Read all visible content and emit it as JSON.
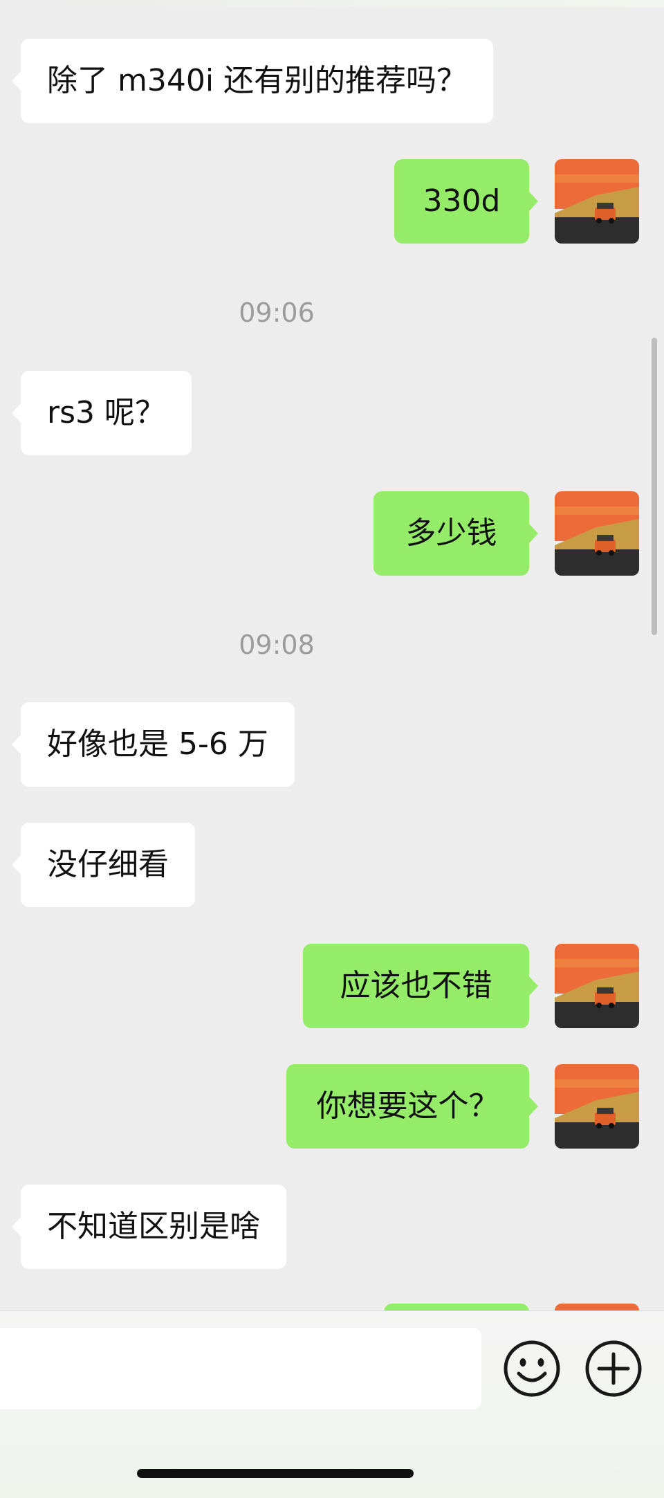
{
  "chat": {
    "messages": [
      {
        "side": "in",
        "text": "除了 m340i 还有别的推荐吗？"
      },
      {
        "side": "out",
        "text": "330d"
      },
      {
        "type": "time",
        "text": "09:06"
      },
      {
        "side": "in",
        "text": "rs3 呢？"
      },
      {
        "side": "out",
        "text": "多少钱"
      },
      {
        "type": "time",
        "text": "09:08"
      },
      {
        "side": "in",
        "text": "好像也是 5-6 万"
      },
      {
        "side": "in",
        "text": "没仔细看"
      },
      {
        "side": "out",
        "text": "应该也不错"
      },
      {
        "side": "out",
        "text": "你想要这个？"
      },
      {
        "side": "in",
        "text": "不知道区别是啥"
      }
    ]
  },
  "input_bar": {
    "text_value": "",
    "emoji_icon": "smiley-face-icon",
    "plus_icon": "plus-circle-icon"
  },
  "colors": {
    "background": "#ededed",
    "incoming_bubble": "#ffffff",
    "outgoing_bubble": "#95ec69",
    "timestamp": "#9b9b9b"
  }
}
